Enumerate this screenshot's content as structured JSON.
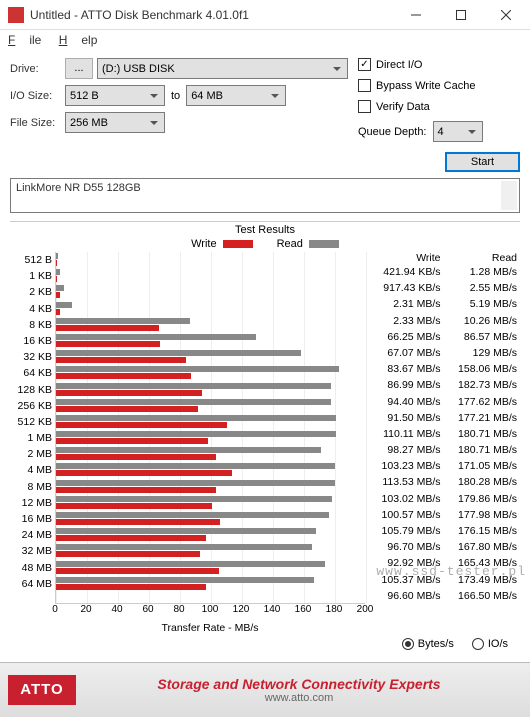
{
  "window": {
    "title": "Untitled - ATTO Disk Benchmark 4.01.0f1"
  },
  "menu": {
    "file": "File",
    "help": "Help"
  },
  "form": {
    "drive_label": "Drive:",
    "drive_value": "(D:) USB DISK",
    "ellipsis": "...",
    "io_label": "I/O Size:",
    "io_from": "512 B",
    "io_to_label": "to",
    "io_to": "64 MB",
    "filesize_label": "File Size:",
    "filesize_value": "256 MB"
  },
  "options": {
    "direct_io": "Direct I/O",
    "bypass": "Bypass Write Cache",
    "verify": "Verify Data",
    "queue_label": "Queue Depth:",
    "queue_value": "4",
    "start": "Start"
  },
  "description": "LinkMore NR D55 128GB",
  "results_title": "Test Results",
  "legend": {
    "write": "Write",
    "read": "Read"
  },
  "colors": {
    "write": "#d42020",
    "read": "#888888"
  },
  "chart_data": {
    "type": "bar",
    "title": "Test Results",
    "xlabel": "Transfer Rate - MB/s",
    "xlim": [
      0,
      200
    ],
    "xticks": [
      0,
      20,
      40,
      60,
      80,
      100,
      120,
      140,
      160,
      180,
      200
    ],
    "categories": [
      "512 B",
      "1 KB",
      "2 KB",
      "4 KB",
      "8 KB",
      "16 KB",
      "32 KB",
      "64 KB",
      "128 KB",
      "256 KB",
      "512 KB",
      "1 MB",
      "2 MB",
      "4 MB",
      "8 MB",
      "12 MB",
      "16 MB",
      "24 MB",
      "32 MB",
      "48 MB",
      "64 MB"
    ],
    "series": [
      {
        "name": "Write",
        "color": "#d42020",
        "values": [
          0.412,
          0.896,
          2.31,
          2.33,
          66.25,
          67.07,
          83.67,
          86.99,
          94.4,
          91.5,
          110.11,
          98.27,
          103.23,
          113.53,
          103.02,
          100.57,
          105.79,
          96.7,
          92.92,
          105.37,
          96.6
        ],
        "labels": [
          "421.94 KB/s",
          "917.43 KB/s",
          "2.31 MB/s",
          "2.33 MB/s",
          "66.25 MB/s",
          "67.07 MB/s",
          "83.67 MB/s",
          "86.99 MB/s",
          "94.40 MB/s",
          "91.50 MB/s",
          "110.11 MB/s",
          "98.27 MB/s",
          "103.23 MB/s",
          "113.53 MB/s",
          "103.02 MB/s",
          "100.57 MB/s",
          "105.79 MB/s",
          "96.70 MB/s",
          "92.92 MB/s",
          "105.37 MB/s",
          "96.60 MB/s"
        ]
      },
      {
        "name": "Read",
        "color": "#888888",
        "values": [
          1.28,
          2.55,
          5.19,
          10.26,
          86.57,
          129,
          158.06,
          182.73,
          177.62,
          177.21,
          180.71,
          180.71,
          171.05,
          180.28,
          179.86,
          177.98,
          176.15,
          167.8,
          165.43,
          173.49,
          166.5
        ],
        "labels": [
          "1.28 MB/s",
          "2.55 MB/s",
          "5.19 MB/s",
          "10.26 MB/s",
          "86.57 MB/s",
          "129 MB/s",
          "158.06 MB/s",
          "182.73 MB/s",
          "177.62 MB/s",
          "177.21 MB/s",
          "180.71 MB/s",
          "180.71 MB/s",
          "171.05 MB/s",
          "180.28 MB/s",
          "179.86 MB/s",
          "177.98 MB/s",
          "176.15 MB/s",
          "167.80 MB/s",
          "165.43 MB/s",
          "173.49 MB/s",
          "166.50 MB/s"
        ]
      }
    ]
  },
  "unit_radios": {
    "bytes": "Bytes/s",
    "ios": "IO/s"
  },
  "footer": {
    "logo": "ATTO",
    "line1": "Storage and Network Connectivity Experts",
    "line2": "www.atto.com"
  },
  "watermark": "www.ssd-tester.pl"
}
